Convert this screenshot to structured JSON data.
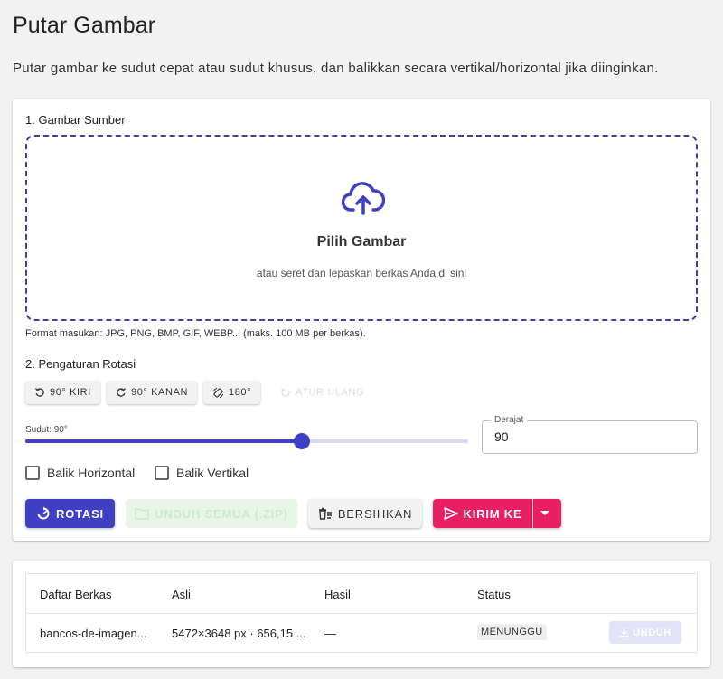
{
  "page": {
    "title": "Putar Gambar",
    "subtitle": "Putar gambar ke sudut cepat atau sudut khusus, dan balikkan secara vertikal/horizontal jika diinginkan."
  },
  "source": {
    "section_label": "1. Gambar Sumber",
    "dropzone_title": "Pilih Gambar",
    "dropzone_subtitle": "atau seret dan lepaskan berkas Anda di sini",
    "formats_note": "Format masukan: JPG, PNG, BMP, GIF, WEBP... (maks. 100 MB per berkas)."
  },
  "rotation": {
    "section_label": "2. Pengaturan Rotasi",
    "quick_buttons": [
      "90° KIRI",
      "90° KANAN",
      "180°"
    ],
    "reset_label": "ATUR ULANG",
    "slider_label": "Sudut: 90°",
    "slider_value": 90,
    "slider_min": -360,
    "slider_max": 360,
    "degree_field_label": "Derajat",
    "degree_value": "90",
    "flip_horizontal_label": "Balik Horizontal",
    "flip_vertical_label": "Balik Vertikal"
  },
  "actions": {
    "rotate_label": "ROTASI",
    "download_all_label": "UNDUH SEMUA (.ZIP)",
    "clear_label": "BERSIHKAN",
    "send_label": "KIRIM KE"
  },
  "files_table": {
    "headers": [
      "Daftar Berkas",
      "Asli",
      "Hasil",
      "Status"
    ],
    "rows": [
      {
        "name": "bancos-de-imagen...",
        "original": "5472×3648 px · 656,15 ...",
        "result": "—",
        "status": "MENUNGGU",
        "download_label": "UNDUH"
      }
    ]
  },
  "colors": {
    "primary": "#3f3fc4",
    "accent": "#e91e63",
    "background": "#f2f2f2"
  }
}
